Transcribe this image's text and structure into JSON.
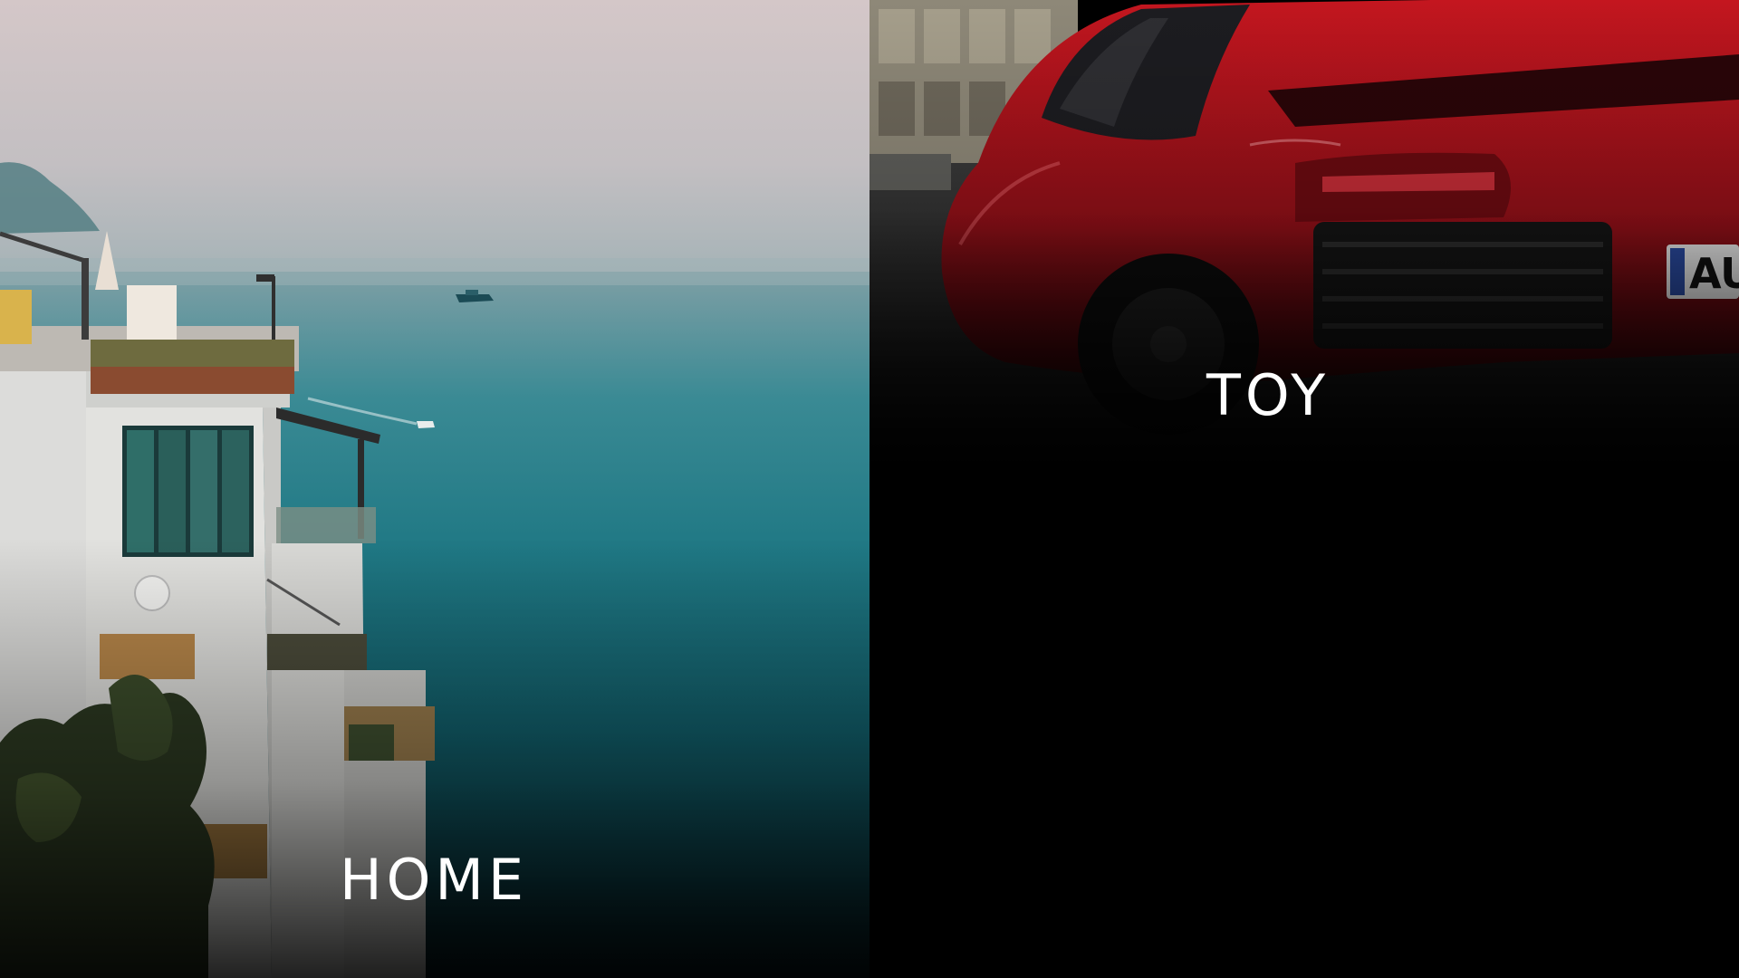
{
  "panels": [
    {
      "id": "home",
      "label": "HOME",
      "scene": "coastal-building-sea-photo"
    },
    {
      "id": "toy",
      "label": "TOY",
      "scene": "red-sports-car-photo"
    }
  ],
  "colors": {
    "label_text": "#ffffff",
    "sea_teal": "#1f7884",
    "car_red": "#b0121c",
    "background": "#000000"
  }
}
